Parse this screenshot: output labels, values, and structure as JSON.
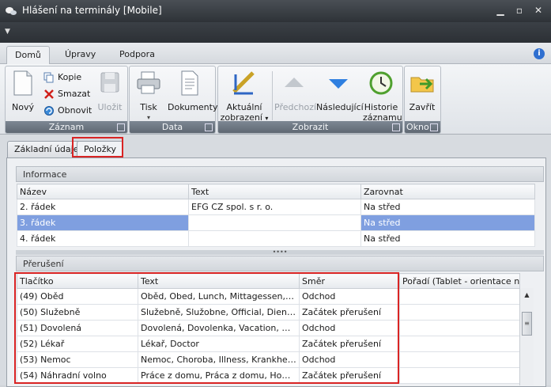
{
  "window": {
    "title": "Hlášení na terminály [Mobile]"
  },
  "ribbon_tabs": [
    "Domů",
    "Úpravy",
    "Podpora"
  ],
  "ribbon": {
    "zaznam": {
      "label": "Záznam",
      "novy": "Nový",
      "kopie": "Kopie",
      "smazat": "Smazat",
      "obnovit": "Obnovit",
      "ulozit": "Uložit"
    },
    "data": {
      "label": "Data",
      "tisk": "Tisk",
      "dokumenty": "Dokumenty"
    },
    "zobrazit": {
      "label": "Zobrazit",
      "aktualni_1": "Aktuální",
      "aktualni_2": "zobrazení",
      "predchozi": "Předchozí",
      "nasledujici": "Následující",
      "historie_1": "Historie",
      "historie_2": "záznamu"
    },
    "okno": {
      "label": "Okno",
      "zavrit": "Zavřít"
    }
  },
  "page_tabs": [
    "Základní údaje",
    "Položky"
  ],
  "informace": {
    "title": "Informace",
    "columns": [
      "Název",
      "Text",
      "Zarovnat"
    ],
    "rows": [
      [
        "2. řádek",
        "EFG CZ spol. s r. o.",
        "Na střed"
      ],
      [
        "3. řádek",
        "",
        "Na střed"
      ],
      [
        "4. řádek",
        "",
        "Na střed"
      ]
    ]
  },
  "preruseni": {
    "title": "Přerušení",
    "columns": [
      "Tlačítko",
      "Text",
      "Směr",
      "Pořadí (Tablet - orientace n..."
    ],
    "rows": [
      [
        "(49) Oběd",
        "Oběd, Obed, Lunch, Mittagessen, Ebéd",
        "Odchod",
        ""
      ],
      [
        "(50) Služebně",
        "Služebně, Služobne, Official, Dienstlic...",
        "Začátek přerušení",
        ""
      ],
      [
        "(51) Dovolená",
        "Dovolená, Dovolenka, Vacation, Urlau...",
        "Odchod",
        ""
      ],
      [
        "(52) Lékař",
        "Lékař, Doctor",
        "Začátek přerušení",
        ""
      ],
      [
        "(53) Nemoc",
        "Nemoc, Choroba, Illness, Krankheit, B...",
        "Odchod",
        ""
      ],
      [
        "(54) Náhradní volno",
        "Práce z domu, Práca z domu, Home O...",
        "Začátek přerušení",
        ""
      ]
    ]
  }
}
